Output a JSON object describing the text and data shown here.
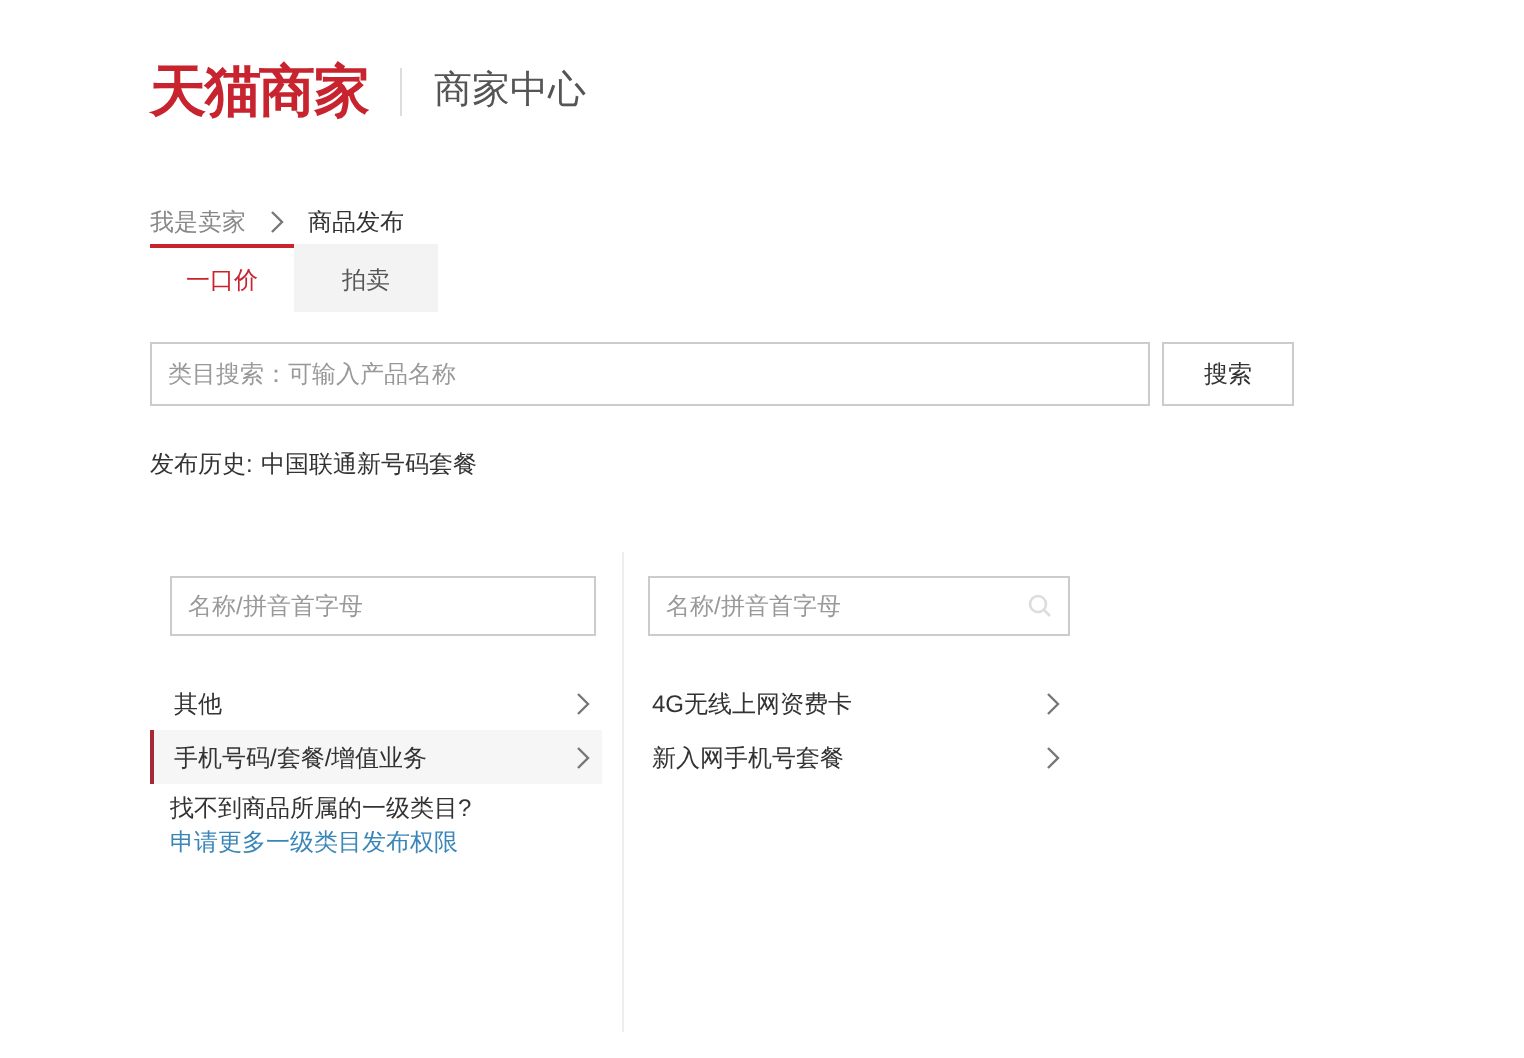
{
  "header": {
    "logo": "天猫商家",
    "subtitle": "商家中心"
  },
  "breadcrumb": [
    {
      "label": "我是卖家"
    },
    {
      "label": "商品发布"
    }
  ],
  "tabs": [
    {
      "label": "一口价",
      "selected": true
    },
    {
      "label": "拍卖",
      "selected": false
    }
  ],
  "search": {
    "placeholder": "类目搜索：可输入产品名称",
    "button": "搜索"
  },
  "history": {
    "label": "发布历史:",
    "value": "中国联通新号码套餐"
  },
  "columns": [
    {
      "placeholder": "名称/拼音首字母",
      "items": [
        {
          "label": "其他",
          "selected": false
        },
        {
          "label": "手机号码/套餐/增值业务",
          "selected": true
        }
      ],
      "note": {
        "text": "找不到商品所属的一级类目?",
        "link": "申请更多一级类目发布权限"
      }
    },
    {
      "placeholder": "名称/拼音首字母",
      "items": [
        {
          "label": "4G无线上网资费卡",
          "selected": false
        },
        {
          "label": "新入网手机号套餐",
          "selected": false
        }
      ]
    }
  ]
}
